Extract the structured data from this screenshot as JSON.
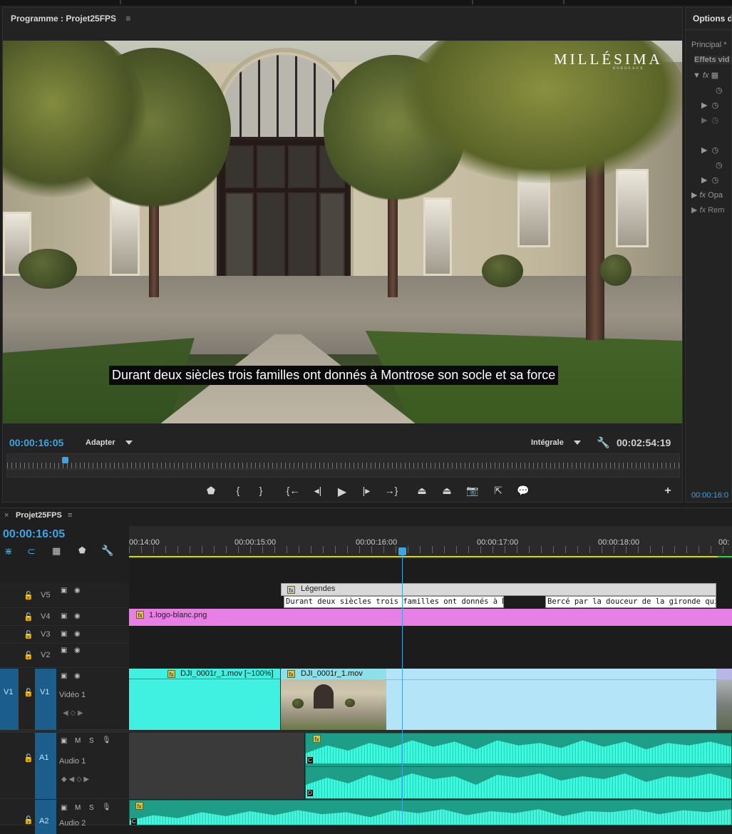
{
  "program": {
    "title": "Programme : Projet25FPS",
    "menu_icon": "≡",
    "subtitle_text": "Durant deux siècles trois familles ont donnés à Montrose son socle et sa force",
    "logo_text": "MILLÉSIMA",
    "logo_subtext": "BORDEAUX",
    "timecode_current": "00:00:16:05",
    "zoom_label": "Adapter",
    "resolution_label": "Intégrale",
    "timecode_duration": "00:02:54:19",
    "wrench_icon": "wrench-icon",
    "controls": [
      "marker-icon",
      "mark-in-icon",
      "mark-out-icon",
      "go-to-in-icon",
      "step-back-icon",
      "play-icon",
      "step-forward-icon",
      "go-to-out-icon",
      "lift-icon",
      "extract-icon",
      "export-frame-icon",
      "button-editor-icon",
      "captions-icon"
    ],
    "add_button": "+"
  },
  "effect_controls": {
    "title": "Options d'",
    "tab": "Principal *",
    "section": "Effets vid",
    "opacity_label": "Opa",
    "remap_label": "Rem",
    "timecode": "00:00:16:0"
  },
  "timeline": {
    "close": "×",
    "title": "Projet25FPS",
    "menu_icon": "≡",
    "timecode": "00:00:16:05",
    "ruler_labels": [
      "00:14:00",
      "00:00:15:00",
      "00:00:16:00",
      "00:00:17:00",
      "00:00:18:00",
      "00:"
    ],
    "tracks": {
      "v5": "V5",
      "v4": "V4",
      "v3": "V3",
      "v2": "V2",
      "v1_source": "V1",
      "v1": "V1",
      "v1_name": "Vidéo 1",
      "a1": "A1",
      "a1_name": "Audio 1",
      "a2": "A2",
      "a2_name": "Audio 2",
      "mute": "M",
      "solo": "S"
    },
    "clips": {
      "captions_track": "Légendes",
      "caption1": "Durant deux siècles trois familles ont donnés à Montros",
      "caption2": "Bercé par la douceur de la gironde qui effleu",
      "logo_clip": "1.logo-blanc.png",
      "video_clip1": "DJI_0001r_1.mov [~100%]",
      "video_clip2": "DJI_0001r_1.mov",
      "audio_ch_c": "C",
      "audio_ch_d": "D",
      "fx_badge": "fx"
    }
  },
  "colors": {
    "timecode": "#3da5e6",
    "video_clip": "#40f0e0",
    "logo_clip": "#e77fe4",
    "audio_clip": "#3cf5da",
    "track_selected": "#1b5e8c"
  }
}
